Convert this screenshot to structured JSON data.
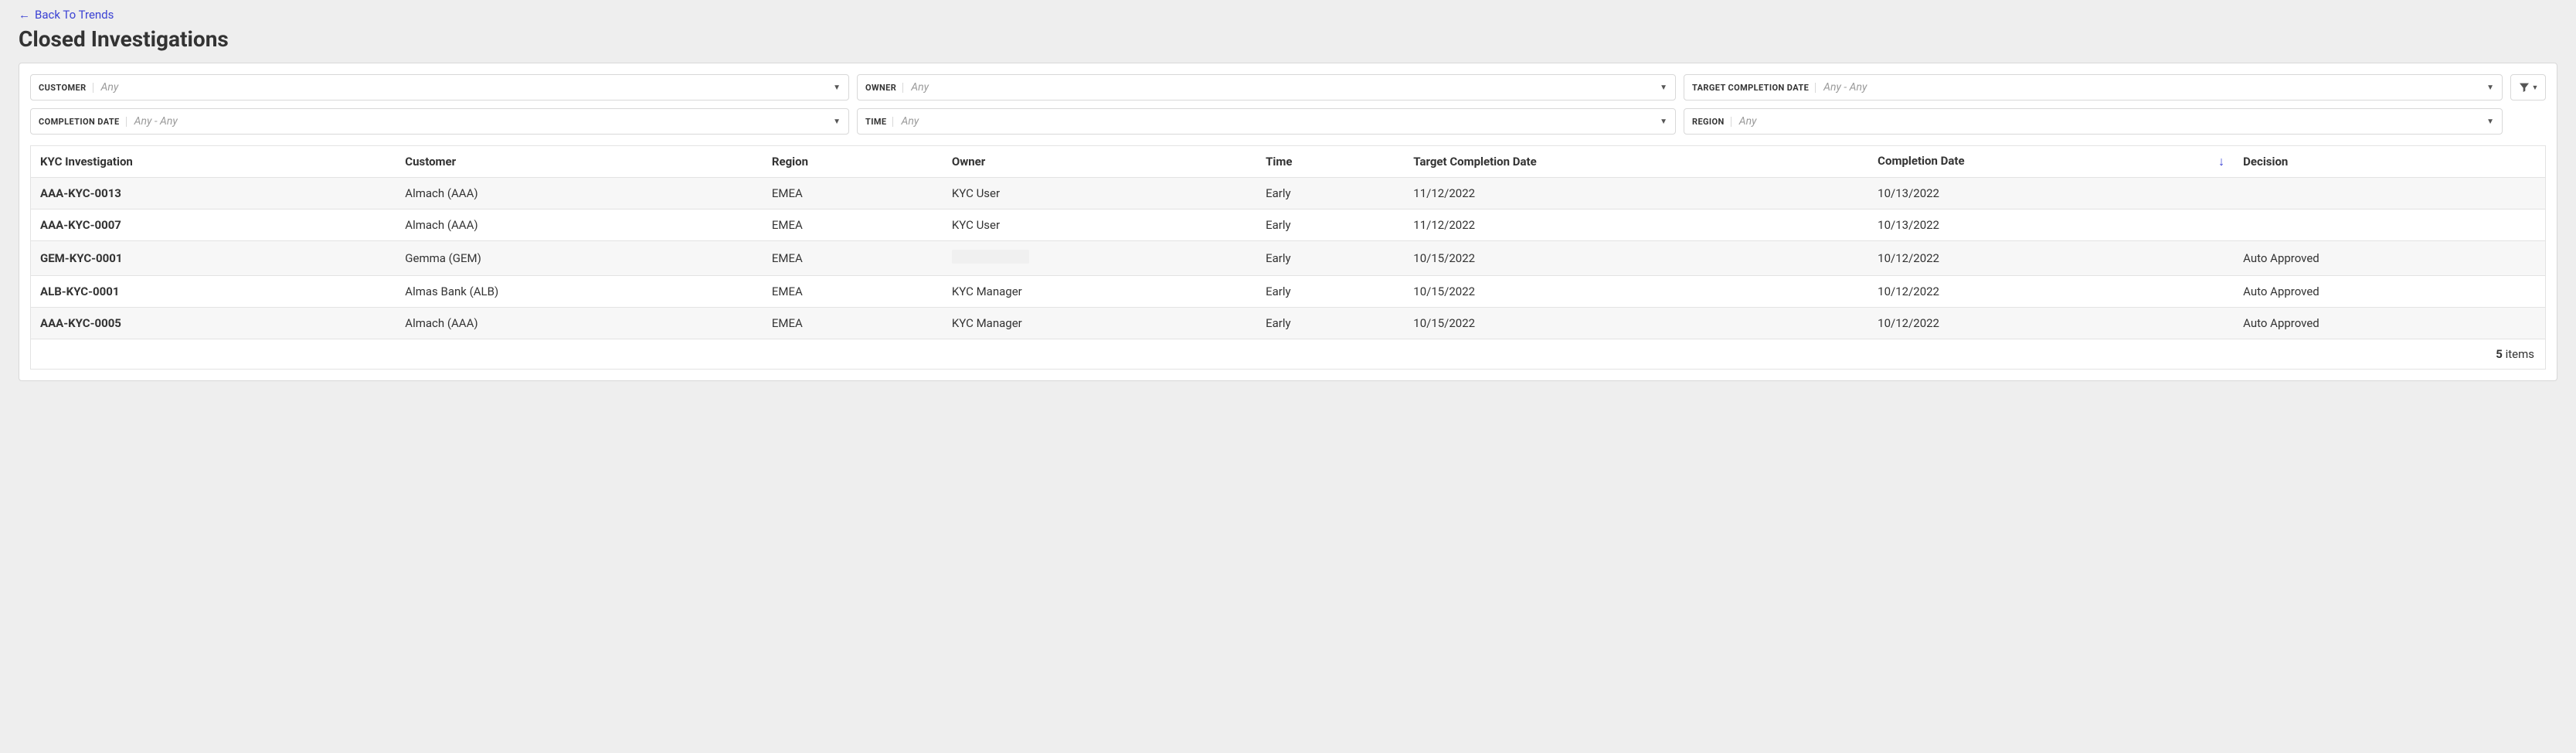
{
  "nav": {
    "back_label": "Back To Trends"
  },
  "header": {
    "title": "Closed Investigations"
  },
  "filters": {
    "customer": {
      "label": "CUSTOMER",
      "value": "Any"
    },
    "owner": {
      "label": "OWNER",
      "value": "Any"
    },
    "target_completion_date": {
      "label": "TARGET COMPLETION DATE",
      "value": "Any - Any"
    },
    "completion_date": {
      "label": "COMPLETION DATE",
      "value": "Any - Any"
    },
    "time": {
      "label": "TIME",
      "value": "Any"
    },
    "region": {
      "label": "REGION",
      "value": "Any"
    }
  },
  "table": {
    "columns": {
      "kyc": "KYC Investigation",
      "customer": "Customer",
      "region": "Region",
      "owner": "Owner",
      "time": "Time",
      "target_completion_date": "Target Completion Date",
      "completion_date": "Completion Date",
      "decision": "Decision"
    },
    "sort_column": "completion_date",
    "sort_direction_label": "↓",
    "rows": [
      {
        "kyc": "AAA-KYC-0013",
        "customer": "Almach (AAA)",
        "region": "EMEA",
        "owner": "KYC User",
        "time": "Early",
        "target": "11/12/2022",
        "completion": "10/13/2022",
        "decision": ""
      },
      {
        "kyc": "AAA-KYC-0007",
        "customer": "Almach (AAA)",
        "region": "EMEA",
        "owner": "KYC User",
        "time": "Early",
        "target": "11/12/2022",
        "completion": "10/13/2022",
        "decision": ""
      },
      {
        "kyc": "GEM-KYC-0001",
        "customer": "Gemma (GEM)",
        "region": "EMEA",
        "owner": "",
        "time": "Early",
        "target": "10/15/2022",
        "completion": "10/12/2022",
        "decision": "Auto Approved"
      },
      {
        "kyc": "ALB-KYC-0001",
        "customer": "Almas Bank (ALB)",
        "region": "EMEA",
        "owner": "KYC Manager",
        "time": "Early",
        "target": "10/15/2022",
        "completion": "10/12/2022",
        "decision": "Auto Approved"
      },
      {
        "kyc": "AAA-KYC-0005",
        "customer": "Almach (AAA)",
        "region": "EMEA",
        "owner": "KYC Manager",
        "time": "Early",
        "target": "10/15/2022",
        "completion": "10/12/2022",
        "decision": "Auto Approved"
      }
    ],
    "footer": {
      "count": "5",
      "suffix": "items"
    }
  }
}
